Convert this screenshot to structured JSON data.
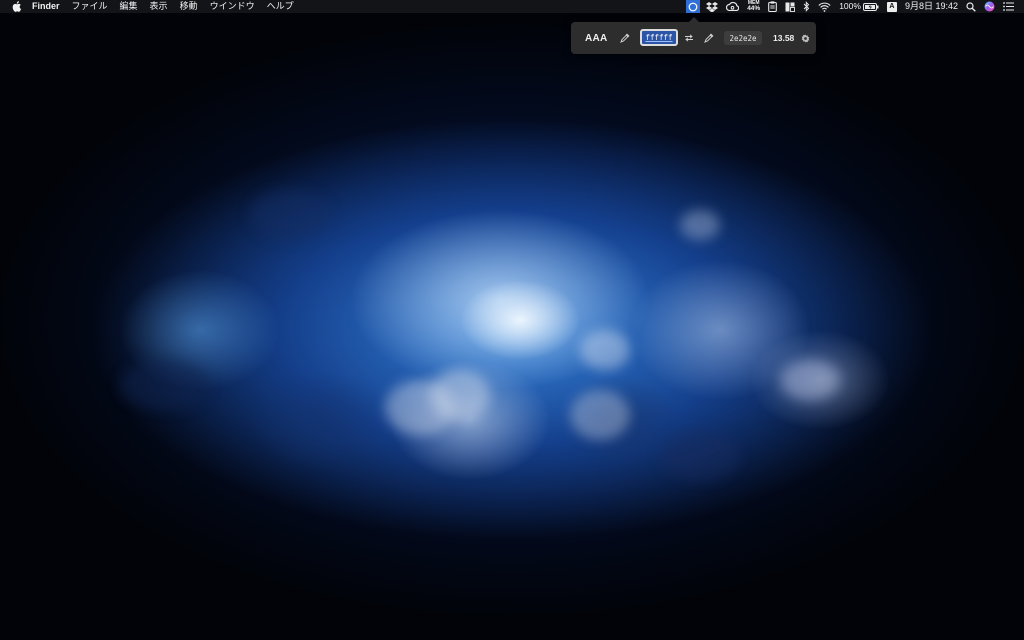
{
  "menubar": {
    "app_name": "Finder",
    "menus": [
      "ファイル",
      "編集",
      "表示",
      "移動",
      "ウインドウ",
      "ヘルプ"
    ],
    "memory": {
      "label": "MEM",
      "percent": "44%"
    },
    "battery": {
      "percent": "100%"
    },
    "input_source": "A",
    "clock": "9月8日 19:42"
  },
  "contrast_popover": {
    "rating": "AAA",
    "foreground_hex": "ffffff",
    "background_hex": "2e2e2e",
    "contrast_ratio": "13.58"
  },
  "colors": {
    "menubar_bg": "#14161a",
    "popover_bg": "#2e2e2e",
    "active_status": "#2f6fd6",
    "hex_field_bg": "#2c55a8"
  }
}
